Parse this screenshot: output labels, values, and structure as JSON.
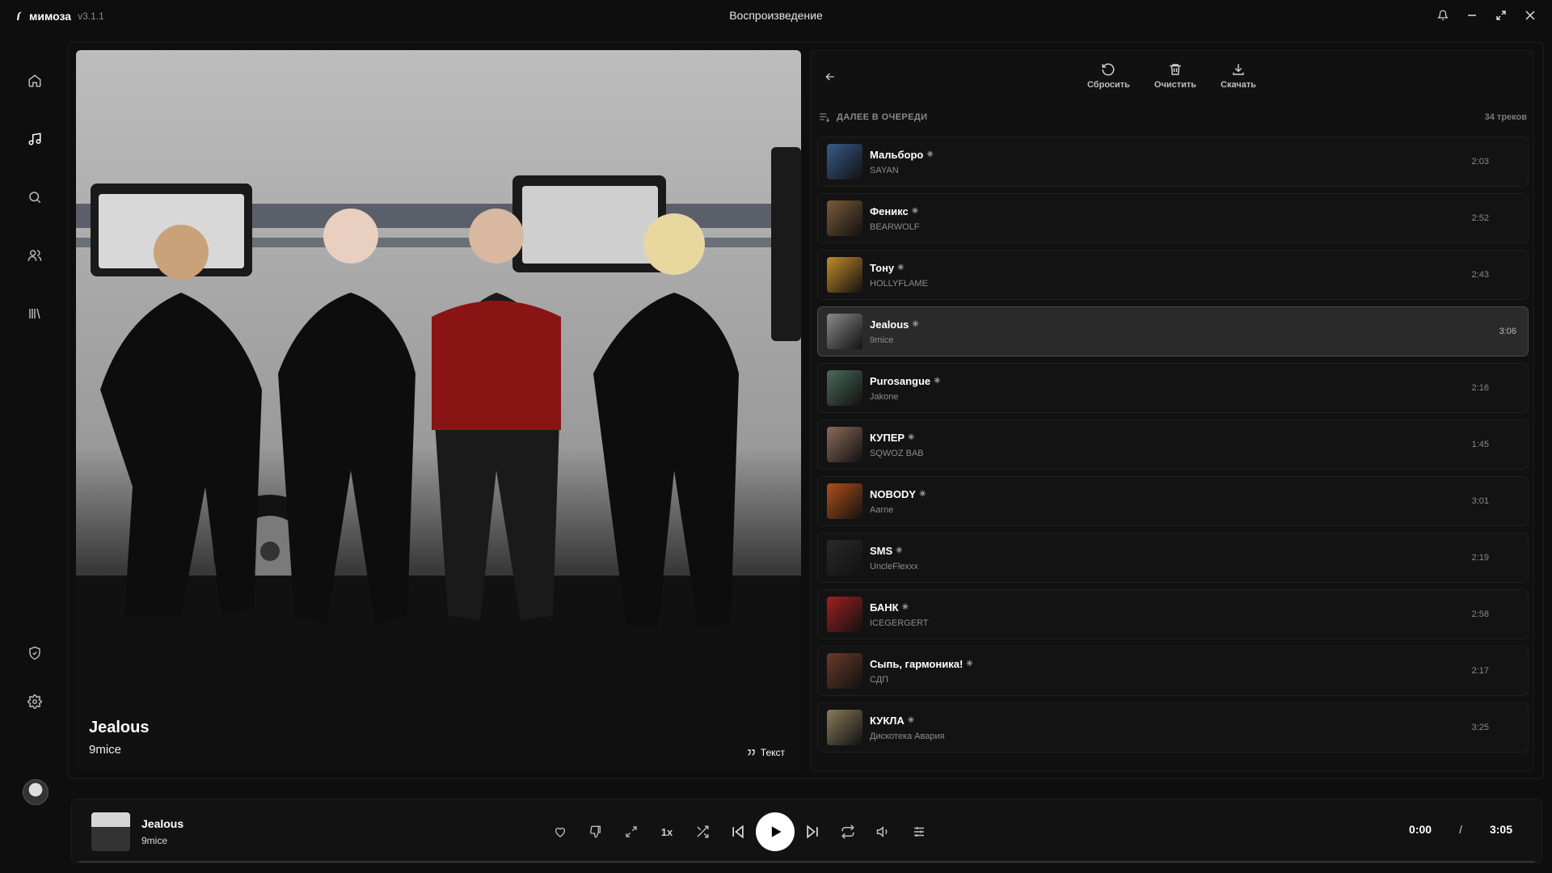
{
  "app": {
    "name": "мимоза",
    "version": "v3.1.1",
    "window_title": "Воспроизведение"
  },
  "sidebar": {
    "items": [
      {
        "icon": "home-icon"
      },
      {
        "icon": "music-note-icon",
        "active": true
      },
      {
        "icon": "search-icon"
      },
      {
        "icon": "users-icon"
      },
      {
        "icon": "library-icon"
      },
      {
        "icon": "shield-icon"
      },
      {
        "icon": "gear-icon"
      }
    ]
  },
  "now_playing": {
    "title": "Jealous",
    "artist": "9mice",
    "lyrics_label": "Текст"
  },
  "queue": {
    "actions": {
      "reset": "Сбросить",
      "clear": "Очистить",
      "download": "Скачать"
    },
    "heading": "ДАЛЕЕ В ОЧЕРЕДИ",
    "count": "34 треков",
    "tracks": [
      {
        "title": "Мальборо",
        "artist": "SAYAN",
        "duration": "2:03",
        "color": "#3a5a8a"
      },
      {
        "title": "Феникс",
        "artist": "BEARWOLF",
        "duration": "2:52",
        "color": "#7a5a3a"
      },
      {
        "title": "Тону",
        "artist": "HOLLYFLAME",
        "duration": "2:43",
        "color": "#c48a2a"
      },
      {
        "title": "Jealous",
        "artist": "9mice",
        "duration": "3:06",
        "color": "#8a8a8a",
        "active": true
      },
      {
        "title": "Purosangue",
        "artist": "Jakone",
        "duration": "2:16",
        "color": "#4a6a5a"
      },
      {
        "title": "КУПЕР",
        "artist": "SQWOZ BAB",
        "duration": "1:45",
        "color": "#8a6a5a"
      },
      {
        "title": "NOBODY",
        "artist": "Aarne",
        "duration": "3:01",
        "color": "#b0501a"
      },
      {
        "title": "SMS",
        "artist": "UncleFlexxx",
        "duration": "2:19",
        "color": "#2a2a2a"
      },
      {
        "title": "БАНК",
        "artist": "ICEGERGERT",
        "duration": "2:58",
        "color": "#a02020"
      },
      {
        "title": "Сыпь, гармоника!",
        "artist": "СДП",
        "duration": "2:17",
        "color": "#6a3a2a"
      },
      {
        "title": "КУКЛА",
        "artist": "Дискотека Авария",
        "duration": "3:25",
        "color": "#8a7a5a"
      }
    ]
  },
  "player": {
    "title": "Jealous",
    "artist": "9mice",
    "speed": "1x",
    "current_time": "0:00",
    "separator": "/",
    "total_time": "3:05",
    "progress": 0
  }
}
